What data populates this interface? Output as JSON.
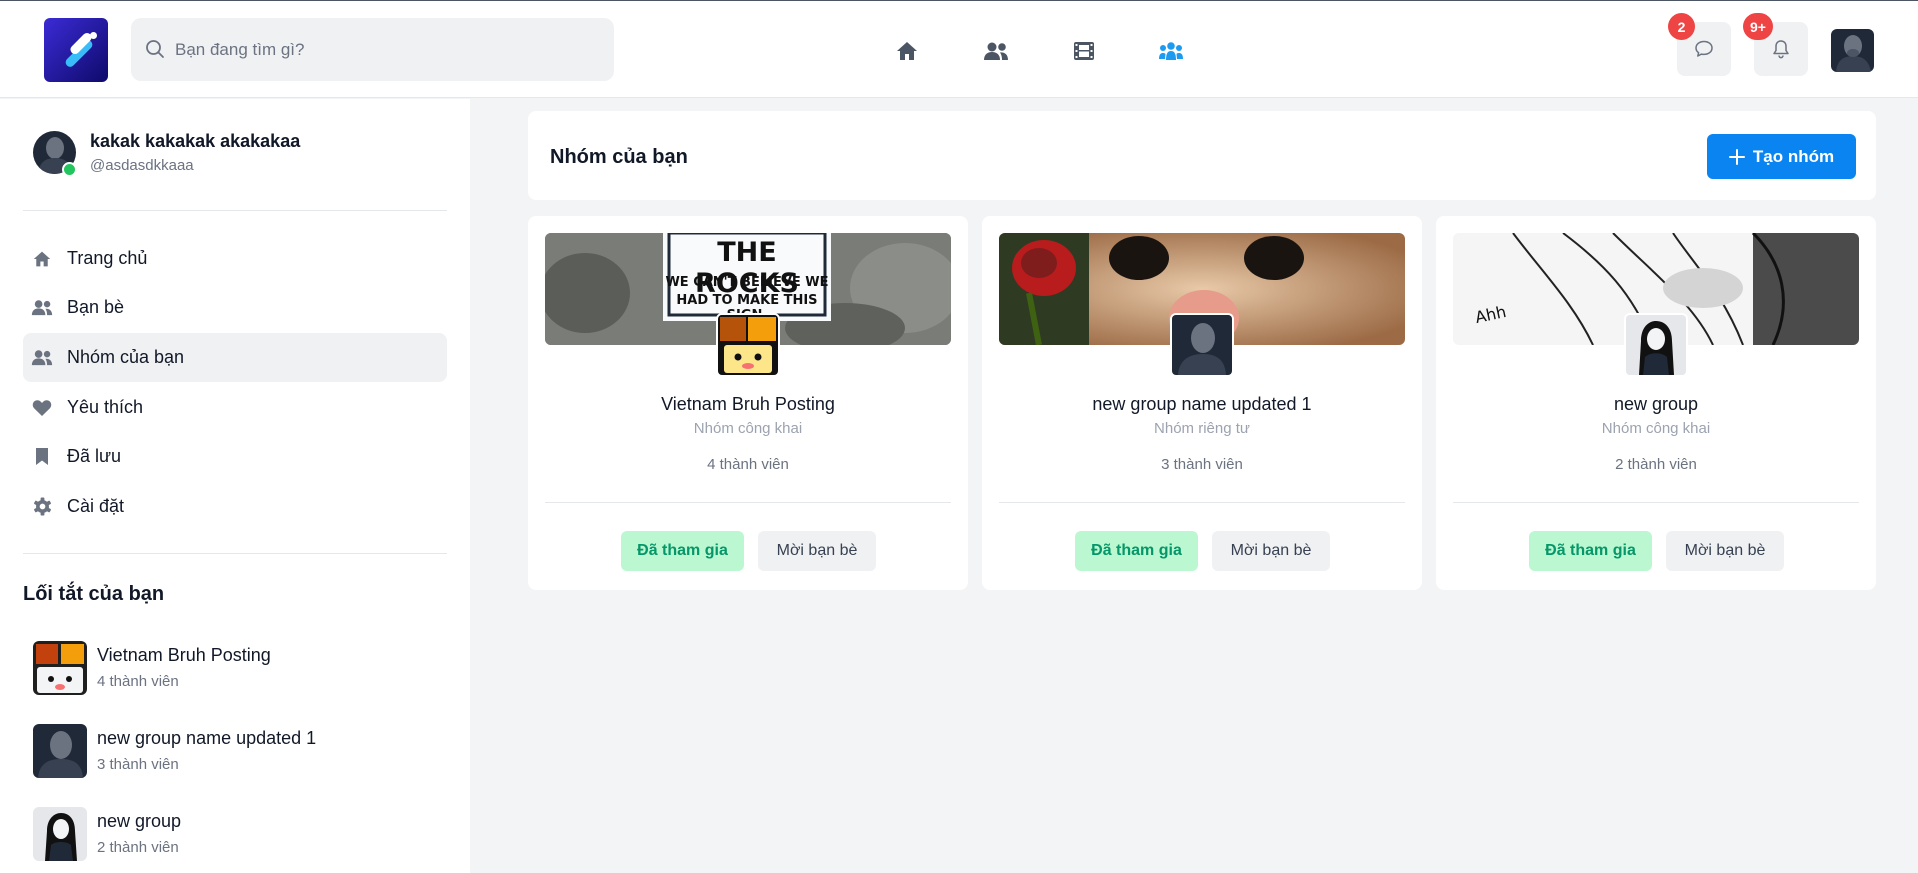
{
  "header": {
    "search_placeholder": "Bạn đang tìm gì?",
    "nav": [
      "home-icon",
      "friends-icon",
      "video-icon",
      "groups-icon"
    ],
    "messages_badge": "2",
    "notifications_badge": "9+",
    "active_nav_color": "#1d9bf0"
  },
  "profile": {
    "name": "kakak kakakak akakakaa",
    "handle": "@asdasdkkaaa",
    "status": "online"
  },
  "menu": [
    {
      "label": "Trang chủ",
      "icon": "home-icon"
    },
    {
      "label": "Bạn bè",
      "icon": "friends-icon"
    },
    {
      "label": "Nhóm của bạn",
      "icon": "groups-icon",
      "active": true
    },
    {
      "label": "Yêu thích",
      "icon": "heart-icon"
    },
    {
      "label": "Đã lưu",
      "icon": "bookmark-icon"
    },
    {
      "label": "Cài đặt",
      "icon": "gear-icon"
    }
  ],
  "shortcuts": {
    "title": "Lối tắt của bạn",
    "items": [
      {
        "name": "Vietnam Bruh Posting",
        "count": "4 thành viên"
      },
      {
        "name": "new group name updated 1",
        "count": "3 thành viên"
      },
      {
        "name": "new group",
        "count": "2 thành viên"
      }
    ]
  },
  "main": {
    "title": "Nhóm của bạn",
    "create_label": "Tạo nhóm",
    "create_color": "#0a84f0",
    "groups": [
      {
        "name": "Vietnam Bruh Posting",
        "privacy": "Nhóm công khai",
        "members": "4 thành viên",
        "joined_label": "Đã tham gia",
        "invite_label": "Mời bạn bè",
        "cover_text_1": "THE ROCKS",
        "cover_text_2": "WE CAN'T BELIEVE WE",
        "cover_text_3": "HAD TO MAKE THIS SIGN."
      },
      {
        "name": "new group name updated 1",
        "privacy": "Nhóm riêng tư",
        "members": "3 thành viên",
        "joined_label": "Đã tham gia",
        "invite_label": "Mời bạn bè"
      },
      {
        "name": "new group",
        "privacy": "Nhóm công khai",
        "members": "2 thành viên",
        "joined_label": "Đã tham gia",
        "invite_label": "Mời bạn bè",
        "cover_text": "Ahh"
      }
    ]
  }
}
